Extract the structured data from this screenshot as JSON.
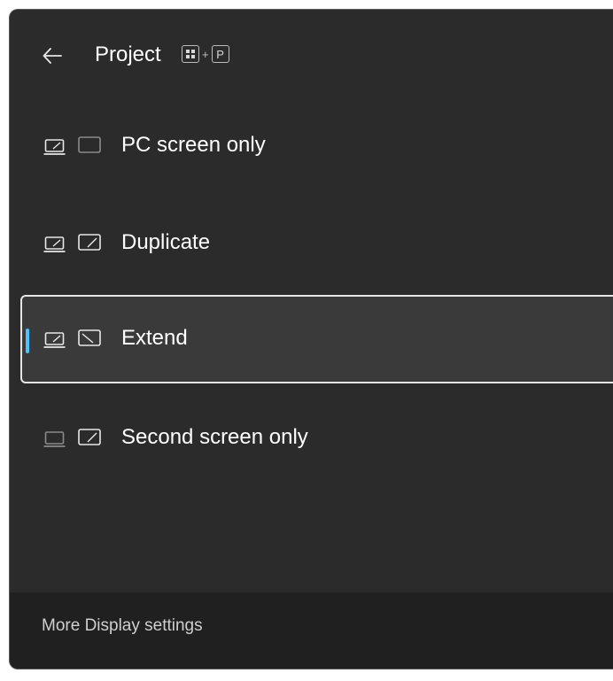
{
  "header": {
    "title": "Project",
    "back_icon": "arrow-left-icon",
    "shortcut_key_1": "windows-logo-key",
    "shortcut_plus": "+",
    "shortcut_key_2": "P"
  },
  "options": [
    {
      "label": "PC screen only",
      "icon": "pc-screen-only-icon",
      "selected": false
    },
    {
      "label": "Duplicate",
      "icon": "duplicate-icon",
      "selected": false
    },
    {
      "label": "Extend",
      "icon": "extend-icon",
      "selected": true
    },
    {
      "label": "Second screen only",
      "icon": "second-screen-only-icon",
      "selected": false
    }
  ],
  "footer": {
    "link_label": "More Display settings"
  },
  "colors": {
    "panel": "#2b2b2b",
    "footer": "#202020",
    "selected": "#3a3a3a",
    "accent": "#4cc2ff",
    "text": "#ffffff"
  }
}
